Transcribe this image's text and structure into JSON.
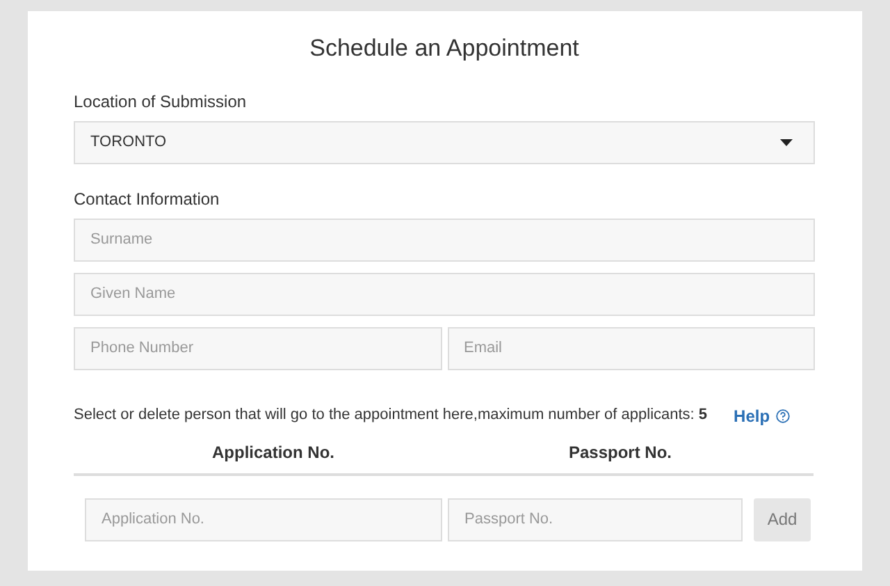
{
  "title": "Schedule an Appointment",
  "location": {
    "label": "Location of Submission",
    "value": "TORONTO"
  },
  "contact": {
    "label": "Contact Information",
    "fields": [
      {
        "placeholder": "Surname"
      },
      {
        "placeholder": "Given Name"
      },
      {
        "placeholder": "Phone Number"
      },
      {
        "placeholder": "Email"
      }
    ]
  },
  "instruction": "Select or delete person that will go to the appointment here,maximum number of applicants: **5**",
  "help": "Help",
  "applicants": {
    "columns": [
      "Application No.",
      "Passport No."
    ],
    "inputs": [
      {
        "placeholder": "Application No."
      },
      {
        "placeholder": "Passport No."
      }
    ],
    "add_button": {
      "label": "Add",
      "disabled": true
    }
  }
}
